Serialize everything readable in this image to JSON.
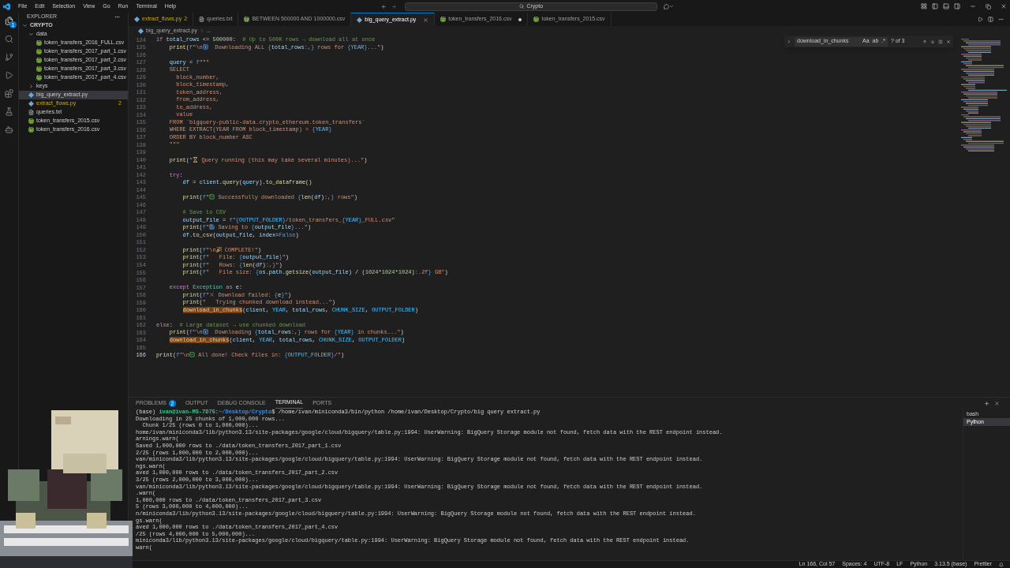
{
  "title_bar": {
    "menu": [
      "File",
      "Edit",
      "Selection",
      "View",
      "Go",
      "Run",
      "Terminal",
      "Help"
    ],
    "search": "Crypto"
  },
  "activity_bar": {
    "badge": "1"
  },
  "explorer": {
    "title": "EXPLORER",
    "root": "CRYPTO",
    "items": [
      {
        "name": "data",
        "kind": "folder",
        "expanded": true,
        "selected": false,
        "children": [
          {
            "name": "token_transfers_2016_FULL.csv",
            "kind": "csv",
            "selected": false
          },
          {
            "name": "token_transfers_2017_part_1.csv",
            "kind": "csv",
            "selected": false
          },
          {
            "name": "token_transfers_2017_part_2.csv",
            "kind": "csv",
            "selected": false
          },
          {
            "name": "token_transfers_2017_part_3.csv",
            "kind": "csv",
            "selected": false
          },
          {
            "name": "token_transfers_2017_part_4.csv",
            "kind": "csv",
            "selected": false
          }
        ]
      },
      {
        "name": "keys",
        "kind": "folder",
        "expanded": false,
        "selected": false
      },
      {
        "name": "big_query_extract.py",
        "kind": "py",
        "selected": true
      },
      {
        "name": "extract_flows.py",
        "kind": "py",
        "selected": false,
        "problems": "2"
      },
      {
        "name": "queries.txt",
        "kind": "txt",
        "selected": false
      },
      {
        "name": "token_transfers_2015.csv",
        "kind": "csv",
        "selected": false
      },
      {
        "name": "token_transfers_2016.csv",
        "kind": "csv",
        "selected": false
      }
    ]
  },
  "tabs": [
    {
      "label": "extract_flows.py",
      "kind": "py",
      "selected": false,
      "dirty": false,
      "problems": "2"
    },
    {
      "label": "queries.txt",
      "kind": "txt",
      "selected": false,
      "dirty": false
    },
    {
      "label": "BETWEEN 500000 AND 1000000.csv",
      "kind": "csv",
      "selected": false,
      "dirty": false
    },
    {
      "label": "big_query_extract.py",
      "kind": "py",
      "selected": true,
      "dirty": false
    },
    {
      "label": "token_transfers_2016.csv",
      "kind": "csv",
      "selected": false,
      "dirty": true
    },
    {
      "label": "token_transfers_2015.csv",
      "kind": "csv",
      "selected": false,
      "dirty": false
    }
  ],
  "breadcrumbs": [
    "big_query_extract.py",
    "..."
  ],
  "find": {
    "query": "download_in_chunks",
    "options": [
      "Aa",
      "ab",
      ".*"
    ],
    "count": "? of 3"
  },
  "code": [
    {
      "n": "124",
      "s": [
        {
          "kind": "kw",
          "t": "if"
        },
        {
          "kind": "v",
          "t": " total_rows"
        },
        {
          "kind": "p",
          "t": " <= "
        },
        {
          "kind": "num",
          "t": "500000"
        },
        {
          "kind": "p",
          "t": ":"
        },
        {
          "kind": "cm",
          "t": "  # Up to 500K rows → download all at once"
        }
      ]
    },
    {
      "n": "125",
      "s": [
        {
          "kind": "fn",
          "t": "    print"
        },
        {
          "kind": "p",
          "t": "("
        },
        {
          "kind": "br",
          "t": "f"
        },
        {
          "kind": "str",
          "t": "\"\\n"
        },
        {
          "kind": "down"
        },
        {
          "kind": "str",
          "t": "  Downloading ALL "
        },
        {
          "kind": "br",
          "t": "{"
        },
        {
          "kind": "v",
          "t": "total_rows"
        },
        {
          "kind": "str",
          "t": ":,"
        },
        {
          "kind": "br",
          "t": "}"
        },
        {
          "kind": "str",
          "t": " rows for "
        },
        {
          "kind": "br",
          "t": "{"
        },
        {
          "kind": "c",
          "t": "YEAR"
        },
        {
          "kind": "br",
          "t": "}"
        },
        {
          "kind": "str",
          "t": "...\""
        },
        {
          "kind": "p",
          "t": ")"
        }
      ]
    },
    {
      "n": "126"
    },
    {
      "n": "127",
      "s": [
        {
          "kind": "v",
          "t": "    query"
        },
        {
          "kind": "p",
          "t": " = "
        },
        {
          "kind": "br",
          "t": "f"
        },
        {
          "kind": "str",
          "t": "\"\"\""
        }
      ]
    },
    {
      "n": "128",
      "s": [
        {
          "kind": "str",
          "t": "    SELECT"
        }
      ]
    },
    {
      "n": "129",
      "s": [
        {
          "kind": "str",
          "t": "      block_number,"
        }
      ]
    },
    {
      "n": "130",
      "s": [
        {
          "kind": "str",
          "t": "      block_timestamp,"
        }
      ]
    },
    {
      "n": "131",
      "s": [
        {
          "kind": "str",
          "t": "      token_address,"
        }
      ]
    },
    {
      "n": "132",
      "s": [
        {
          "kind": "str",
          "t": "      from_address,"
        }
      ]
    },
    {
      "n": "133",
      "s": [
        {
          "kind": "str",
          "t": "      to_address,"
        }
      ]
    },
    {
      "n": "134",
      "s": [
        {
          "kind": "str",
          "t": "      value"
        }
      ]
    },
    {
      "n": "135",
      "s": [
        {
          "kind": "str",
          "t": "    FROM `bigquery-public-data.crypto_ethereum.token_transfers`"
        }
      ]
    },
    {
      "n": "136",
      "s": [
        {
          "kind": "str",
          "t": "    WHERE EXTRACT(YEAR FROM block_timestamp) = "
        },
        {
          "kind": "br",
          "t": "{"
        },
        {
          "kind": "c",
          "t": "YEAR"
        },
        {
          "kind": "br",
          "t": "}"
        }
      ]
    },
    {
      "n": "137",
      "s": [
        {
          "kind": "str",
          "t": "    ORDER BY block_number ASC"
        }
      ]
    },
    {
      "n": "138",
      "s": [
        {
          "kind": "str",
          "t": "    \"\"\""
        }
      ]
    },
    {
      "n": "139"
    },
    {
      "n": "140",
      "s": [
        {
          "kind": "fn",
          "t": "    print"
        },
        {
          "kind": "p",
          "t": "("
        },
        {
          "kind": "str",
          "t": "\""
        },
        {
          "kind": "hourglass"
        },
        {
          "kind": "str",
          "t": " Query running (this may take several minutes)...\""
        },
        {
          "kind": "p",
          "t": ")"
        }
      ]
    },
    {
      "n": "141"
    },
    {
      "n": "142",
      "s": [
        {
          "kind": "kw",
          "t": "    try"
        },
        {
          "kind": "p",
          "t": ":"
        }
      ]
    },
    {
      "n": "143",
      "s": [
        {
          "kind": "v",
          "t": "        df"
        },
        {
          "kind": "p",
          "t": " = "
        },
        {
          "kind": "v",
          "t": "client"
        },
        {
          "kind": "p",
          "t": "."
        },
        {
          "kind": "fn",
          "t": "query"
        },
        {
          "kind": "p",
          "t": "("
        },
        {
          "kind": "v",
          "t": "query"
        },
        {
          "kind": "p",
          "t": ")."
        },
        {
          "kind": "fn",
          "t": "to_dataframe"
        },
        {
          "kind": "p",
          "t": "()"
        }
      ]
    },
    {
      "n": "144"
    },
    {
      "n": "145",
      "s": [
        {
          "kind": "fn",
          "t": "        print"
        },
        {
          "kind": "p",
          "t": "("
        },
        {
          "kind": "br",
          "t": "f"
        },
        {
          "kind": "str",
          "t": "\""
        },
        {
          "kind": "check"
        },
        {
          "kind": "str",
          "t": " Successfully downloaded "
        },
        {
          "kind": "br",
          "t": "{"
        },
        {
          "kind": "fn",
          "t": "len"
        },
        {
          "kind": "p",
          "t": "("
        },
        {
          "kind": "v",
          "t": "df"
        },
        {
          "kind": "p",
          "t": ")"
        },
        {
          "kind": "str",
          "t": ":,"
        },
        {
          "kind": "br",
          "t": "}"
        },
        {
          "kind": "str",
          "t": " rows\""
        },
        {
          "kind": "p",
          "t": ")"
        }
      ]
    },
    {
      "n": "146"
    },
    {
      "n": "147",
      "s": [
        {
          "kind": "cm",
          "t": "        # Save to CSV"
        }
      ]
    },
    {
      "n": "148",
      "s": [
        {
          "kind": "v",
          "t": "        output_file"
        },
        {
          "kind": "p",
          "t": " = "
        },
        {
          "kind": "br",
          "t": "f"
        },
        {
          "kind": "str",
          "t": "\""
        },
        {
          "kind": "br",
          "t": "{"
        },
        {
          "kind": "c",
          "t": "OUTPUT_FOLDER"
        },
        {
          "kind": "br",
          "t": "}"
        },
        {
          "kind": "str",
          "t": "/token_transfers_"
        },
        {
          "kind": "br",
          "t": "{"
        },
        {
          "kind": "c",
          "t": "YEAR"
        },
        {
          "kind": "br",
          "t": "}"
        },
        {
          "kind": "str",
          "t": "_FULL.csv\""
        }
      ]
    },
    {
      "n": "149",
      "s": [
        {
          "kind": "fn",
          "t": "        print"
        },
        {
          "kind": "p",
          "t": "("
        },
        {
          "kind": "br",
          "t": "f"
        },
        {
          "kind": "str",
          "t": "\""
        },
        {
          "kind": "disk"
        },
        {
          "kind": "str",
          "t": " Saving to "
        },
        {
          "kind": "br",
          "t": "{"
        },
        {
          "kind": "v",
          "t": "output_file"
        },
        {
          "kind": "br",
          "t": "}"
        },
        {
          "kind": "str",
          "t": "...\""
        },
        {
          "kind": "p",
          "t": ")"
        }
      ]
    },
    {
      "n": "150",
      "s": [
        {
          "kind": "v",
          "t": "        df"
        },
        {
          "kind": "p",
          "t": "."
        },
        {
          "kind": "fn",
          "t": "to_csv"
        },
        {
          "kind": "p",
          "t": "("
        },
        {
          "kind": "v",
          "t": "output_file"
        },
        {
          "kind": "p",
          "t": ", "
        },
        {
          "kind": "v",
          "t": "index"
        },
        {
          "kind": "p",
          "t": "="
        },
        {
          "kind": "br",
          "t": "False"
        },
        {
          "kind": "p",
          "t": ")"
        }
      ]
    },
    {
      "n": "151"
    },
    {
      "n": "152",
      "s": [
        {
          "kind": "fn",
          "t": "        print"
        },
        {
          "kind": "p",
          "t": "("
        },
        {
          "kind": "br",
          "t": "f"
        },
        {
          "kind": "str",
          "t": "\"\\n"
        },
        {
          "kind": "party"
        },
        {
          "kind": "str",
          "t": " COMPLETE!\""
        },
        {
          "kind": "p",
          "t": ")"
        }
      ]
    },
    {
      "n": "153",
      "s": [
        {
          "kind": "fn",
          "t": "        print"
        },
        {
          "kind": "p",
          "t": "("
        },
        {
          "kind": "br",
          "t": "f"
        },
        {
          "kind": "str",
          "t": "\"   File: "
        },
        {
          "kind": "br",
          "t": "{"
        },
        {
          "kind": "v",
          "t": "output_file"
        },
        {
          "kind": "br",
          "t": "}"
        },
        {
          "kind": "str",
          "t": "\""
        },
        {
          "kind": "p",
          "t": ")"
        }
      ]
    },
    {
      "n": "154",
      "s": [
        {
          "kind": "fn",
          "t": "        print"
        },
        {
          "kind": "p",
          "t": "("
        },
        {
          "kind": "br",
          "t": "f"
        },
        {
          "kind": "str",
          "t": "\"   Rows: "
        },
        {
          "kind": "br",
          "t": "{"
        },
        {
          "kind": "fn",
          "t": "len"
        },
        {
          "kind": "p",
          "t": "("
        },
        {
          "kind": "v",
          "t": "df"
        },
        {
          "kind": "p",
          "t": ")"
        },
        {
          "kind": "str",
          "t": ":,"
        },
        {
          "kind": "br",
          "t": "}"
        },
        {
          "kind": "str",
          "t": "\""
        },
        {
          "kind": "p",
          "t": ")"
        }
      ]
    },
    {
      "n": "155",
      "s": [
        {
          "kind": "fn",
          "t": "        print"
        },
        {
          "kind": "p",
          "t": "("
        },
        {
          "kind": "br",
          "t": "f"
        },
        {
          "kind": "str",
          "t": "\"   File size: "
        },
        {
          "kind": "br",
          "t": "{"
        },
        {
          "kind": "v",
          "t": "os"
        },
        {
          "kind": "p",
          "t": "."
        },
        {
          "kind": "v",
          "t": "path"
        },
        {
          "kind": "p",
          "t": "."
        },
        {
          "kind": "fn",
          "t": "getsize"
        },
        {
          "kind": "p",
          "t": "("
        },
        {
          "kind": "v",
          "t": "output_file"
        },
        {
          "kind": "p",
          "t": ") / ("
        },
        {
          "kind": "num",
          "t": "1024"
        },
        {
          "kind": "p",
          "t": "*"
        },
        {
          "kind": "num",
          "t": "1024"
        },
        {
          "kind": "p",
          "t": "*"
        },
        {
          "kind": "num",
          "t": "1024"
        },
        {
          "kind": "p",
          "t": ")"
        },
        {
          "kind": "str",
          "t": ":.2f"
        },
        {
          "kind": "br",
          "t": "}"
        },
        {
          "kind": "str",
          "t": " GB\""
        },
        {
          "kind": "p",
          "t": ")"
        }
      ]
    },
    {
      "n": "156"
    },
    {
      "n": "157",
      "s": [
        {
          "kind": "kw",
          "t": "    except"
        },
        {
          "kind": "cls",
          "t": " Exception"
        },
        {
          "kind": "kw",
          "t": " as"
        },
        {
          "kind": "v",
          "t": " e"
        },
        {
          "kind": "p",
          "t": ":"
        }
      ]
    },
    {
      "n": "158",
      "s": [
        {
          "kind": "fn",
          "t": "        print"
        },
        {
          "kind": "p",
          "t": "("
        },
        {
          "kind": "br",
          "t": "f"
        },
        {
          "kind": "str",
          "t": "\""
        },
        {
          "kind": "cross"
        },
        {
          "kind": "str",
          "t": " Download failed: "
        },
        {
          "kind": "br",
          "t": "{"
        },
        {
          "kind": "v",
          "t": "e"
        },
        {
          "kind": "br",
          "t": "}"
        },
        {
          "kind": "str",
          "t": "\""
        },
        {
          "kind": "p",
          "t": ")"
        }
      ]
    },
    {
      "n": "159",
      "s": [
        {
          "kind": "fn",
          "t": "        print"
        },
        {
          "kind": "p",
          "t": "("
        },
        {
          "kind": "str",
          "t": "\"   Trying chunked download instead...\""
        },
        {
          "kind": "p",
          "t": ")"
        }
      ]
    },
    {
      "n": "160",
      "s": [
        {
          "kind": "match",
          "t": "        download_in_chunks"
        },
        {
          "kind": "p",
          "t": "("
        },
        {
          "kind": "v",
          "t": "client"
        },
        {
          "kind": "p",
          "t": ", "
        },
        {
          "kind": "c",
          "t": "YEAR"
        },
        {
          "kind": "p",
          "t": ", "
        },
        {
          "kind": "v",
          "t": "total_rows"
        },
        {
          "kind": "p",
          "t": ", "
        },
        {
          "kind": "c",
          "t": "CHUNK_SIZE"
        },
        {
          "kind": "p",
          "t": ", "
        },
        {
          "kind": "c",
          "t": "OUTPUT_FOLDER"
        },
        {
          "kind": "p",
          "t": ")"
        }
      ]
    },
    {
      "n": "161"
    },
    {
      "n": "162",
      "s": [
        {
          "kind": "kw",
          "t": "else"
        },
        {
          "kind": "p",
          "t": ":"
        },
        {
          "kind": "cm",
          "t": "  # Large dataset → use chunked download"
        }
      ]
    },
    {
      "n": "163",
      "s": [
        {
          "kind": "fn",
          "t": "    print"
        },
        {
          "kind": "p",
          "t": "("
        },
        {
          "kind": "br",
          "t": "f"
        },
        {
          "kind": "str",
          "t": "\"\\n"
        },
        {
          "kind": "down"
        },
        {
          "kind": "str",
          "t": "  Downloading "
        },
        {
          "kind": "br",
          "t": "{"
        },
        {
          "kind": "v",
          "t": "total_rows"
        },
        {
          "kind": "str",
          "t": ":,"
        },
        {
          "kind": "br",
          "t": "}"
        },
        {
          "kind": "str",
          "t": " rows for "
        },
        {
          "kind": "br",
          "t": "{"
        },
        {
          "kind": "c",
          "t": "YEAR"
        },
        {
          "kind": "br",
          "t": "}"
        },
        {
          "kind": "str",
          "t": " in chunks...\""
        },
        {
          "kind": "p",
          "t": ")"
        }
      ]
    },
    {
      "n": "164",
      "s": [
        {
          "kind": "match",
          "t": "    download_in_chunks"
        },
        {
          "kind": "p",
          "t": "("
        },
        {
          "kind": "v",
          "t": "client"
        },
        {
          "kind": "p",
          "t": ", "
        },
        {
          "kind": "c",
          "t": "YEAR"
        },
        {
          "kind": "p",
          "t": ", "
        },
        {
          "kind": "v",
          "t": "total_rows"
        },
        {
          "kind": "p",
          "t": ", "
        },
        {
          "kind": "c",
          "t": "CHUNK_SIZE"
        },
        {
          "kind": "p",
          "t": ", "
        },
        {
          "kind": "c",
          "t": "OUTPUT_FOLDER"
        },
        {
          "kind": "p",
          "t": ")"
        }
      ]
    },
    {
      "n": "165"
    },
    {
      "n": "166",
      "s": [
        {
          "kind": "fn",
          "t": "print"
        },
        {
          "kind": "p",
          "t": "("
        },
        {
          "kind": "br",
          "t": "f"
        },
        {
          "kind": "str",
          "t": "\"\\n"
        },
        {
          "kind": "check"
        },
        {
          "kind": "str",
          "t": " All done! Check files in: "
        },
        {
          "kind": "br",
          "t": "{"
        },
        {
          "kind": "c",
          "t": "OUTPUT_FOLDER"
        },
        {
          "kind": "br",
          "t": "}"
        },
        {
          "kind": "str",
          "t": "/\""
        },
        {
          "kind": "p",
          "t": ")"
        }
      ]
    }
  ],
  "panel": {
    "tabs": [
      {
        "label": "PROBLEMS",
        "selected": false,
        "badge": "2"
      },
      {
        "label": "OUTPUT",
        "selected": false
      },
      {
        "label": "DEBUG CONSOLE",
        "selected": false
      },
      {
        "label": "TERMINAL",
        "selected": true
      },
      {
        "label": "PORTS",
        "selected": false
      }
    ],
    "terminal": [
      {
        "kind": "prompt",
        "s": [
          {
            "kind": "p",
            "t": "(base)"
          },
          {
            "kind": "user",
            "t": " ivan@ivan-MS-7D75"
          },
          {
            "kind": "p",
            "t": ":"
          },
          {
            "kind": "path",
            "t": "~/Desktop/Crypto"
          },
          {
            "kind": "p",
            "t": "$ /home/ivan/miniconda3/bin/python /home/ivan/Desktop/Crypto/big query extract.py"
          }
        ]
      },
      {
        "kind": "text",
        "text": "Downloading in 25 chunks of 1,000,000 rows..."
      },
      {
        "kind": "text",
        "text": "  Chunk 1/25 (rows 0 to 1,000,000)..."
      },
      {
        "kind": "text",
        "text": "home/ivan/miniconda3/lib/python3.13/site-packages/google/cloud/bigquery/table.py:1994: UserWarning: BigQuery Storage module not found, fetch data with the REST endpoint instead."
      },
      {
        "kind": "text",
        "text": "arnings.warn("
      },
      {
        "kind": "text",
        "text": "Saved 1,000,000 rows to ./data/token_transfers_2017_part_1.csv"
      },
      {
        "kind": "text",
        "text": "2/25 (rows 1,000,000 to 2,000,000)..."
      },
      {
        "kind": "text",
        "text": "van/miniconda3/lib/python3.13/site-packages/google/cloud/bigquery/table.py:1994: UserWarning: BigQuery Storage module not found, fetch data with the REST endpoint instead."
      },
      {
        "kind": "text",
        "text": "ngs.warn("
      },
      {
        "kind": "text",
        "text": "aved 1,000,000 rows to ./data/token_transfers_2017_part_2.csv"
      },
      {
        "kind": "text",
        "text": "3/25 (rows 2,000,000 to 3,000,000)..."
      },
      {
        "kind": "text",
        "text": "van/miniconda3/lib/python3.13/site-packages/google/cloud/bigquery/table.py:1994: UserWarning: BigQuery Storage module not found, fetch data with the REST endpoint instead."
      },
      {
        "kind": "text",
        "text": ".warn("
      },
      {
        "kind": "text",
        "text": "1,000,000 rows to ./data/token_transfers_2017_part_3.csv"
      },
      {
        "kind": "text",
        "text": "5 (rows 3,000,000 to 4,000,000)..."
      },
      {
        "kind": "text",
        "text": "n/miniconda3/lib/python3.13/site-packages/google/cloud/bigquery/table.py:1994: UserWarning: BigQuery Storage module not found, fetch data with the REST endpoint instead."
      },
      {
        "kind": "text",
        "text": "gs.warn("
      },
      {
        "kind": "text",
        "text": "aved 1,000,000 rows to ./data/token_transfers_2017_part_4.csv"
      },
      {
        "kind": "text",
        "text": "/25 (rows 4,000,000 to 5,000,000)..."
      },
      {
        "kind": "text",
        "text": "miniconda3/lib/python3.13/site-packages/google/cloud/bigquery/table.py:1994: UserWarning: BigQuery Storage module not found, fetch data with the REST endpoint instead."
      },
      {
        "kind": "text",
        "text": "warn("
      }
    ],
    "sessions": [
      {
        "name": "bash",
        "selected": false
      },
      {
        "name": "Python",
        "selected": true
      }
    ]
  },
  "overlay": {
    "kind": "picture"
  },
  "status_bar": [
    "Ln 166, Col 57",
    "Spaces: 4",
    "UTF-8",
    "LF",
    "Python",
    "3.13.5 (base)",
    "Prettier"
  ]
}
